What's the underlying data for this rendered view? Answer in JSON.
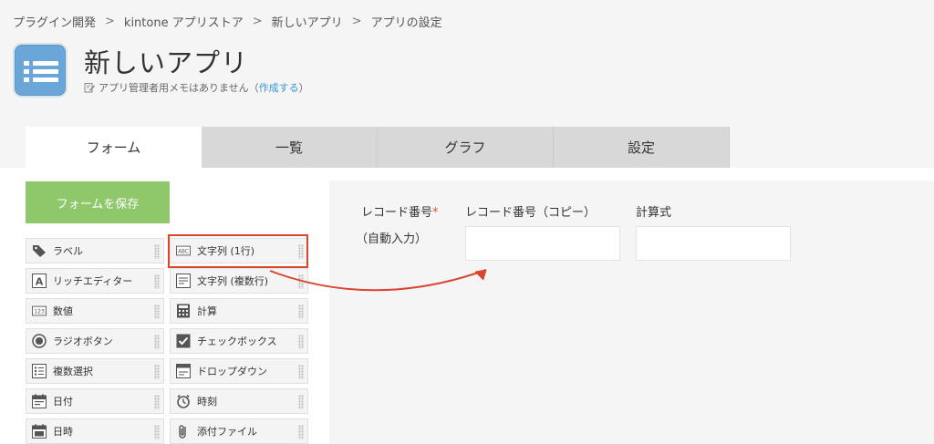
{
  "breadcrumb": {
    "items": [
      "プラグイン開発",
      "kintone アプリストア",
      "新しいアプリ",
      "アプリの設定"
    ],
    "separator": ">"
  },
  "app": {
    "title": "新しいアプリ",
    "memo_text": "アプリ管理者用メモはありません（",
    "memo_link": "作成する",
    "memo_close": "）"
  },
  "tabs": [
    "フォーム",
    "一覧",
    "グラフ",
    "設定"
  ],
  "save_button": "フォームを保存",
  "palette": [
    {
      "label": "ラベル",
      "icon": "tag-icon"
    },
    {
      "label": "文字列 (1行)",
      "icon": "abc-icon"
    },
    {
      "label": "リッチエディター",
      "icon": "rich-editor-icon"
    },
    {
      "label": "文字列 (複数行)",
      "icon": "multiline-icon"
    },
    {
      "label": "数値",
      "icon": "number-icon"
    },
    {
      "label": "計算",
      "icon": "calculator-icon"
    },
    {
      "label": "ラジオボタン",
      "icon": "radio-icon"
    },
    {
      "label": "チェックボックス",
      "icon": "checkbox-icon"
    },
    {
      "label": "複数選択",
      "icon": "multi-select-icon"
    },
    {
      "label": "ドロップダウン",
      "icon": "dropdown-icon"
    },
    {
      "label": "日付",
      "icon": "calendar-icon"
    },
    {
      "label": "時刻",
      "icon": "clock-icon"
    },
    {
      "label": "日時",
      "icon": "datetime-icon"
    },
    {
      "label": "添付ファイル",
      "icon": "paperclip-icon"
    }
  ],
  "form": {
    "record_number_label": "レコード番号",
    "required_mark": "*",
    "auto_input": "（自動入力）",
    "copy_field_label": "レコード番号（コピー）",
    "calc_field_label": "計算式"
  },
  "colors": {
    "accent": "#3498db",
    "save_button": "#8ec86a",
    "highlight": "#d9452f",
    "app_icon": "#6aa6d8"
  }
}
